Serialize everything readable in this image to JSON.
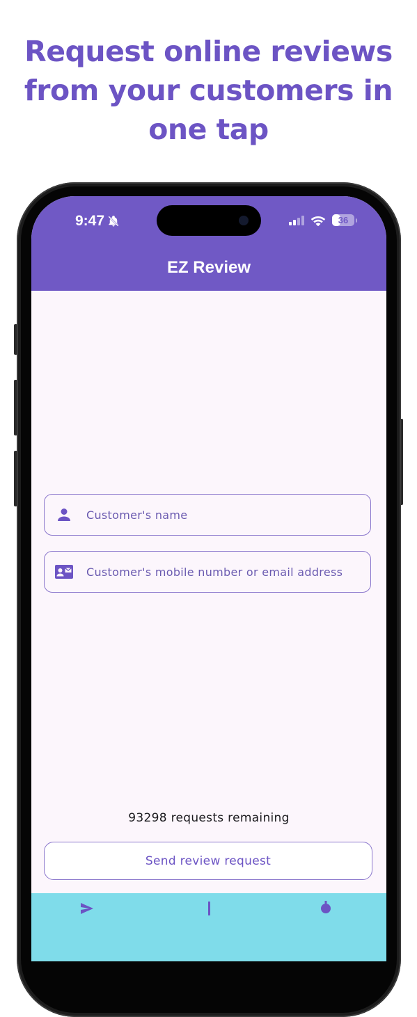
{
  "headline": {
    "line1": "Request online reviews",
    "line2": "from your customers in",
    "line3": "one tap"
  },
  "status_bar": {
    "time": "9:47",
    "battery": "36",
    "icons": [
      "bell-slash-icon",
      "cellular-signal-icon",
      "wifi-icon",
      "battery-icon"
    ]
  },
  "app": {
    "title": "EZ Review"
  },
  "form": {
    "name_placeholder": "Customer's name",
    "contact_placeholder": "Customer's mobile number or email address",
    "name_icon": "person-icon",
    "contact_icon": "contact-card-icon"
  },
  "requests_remaining": "93298 requests remaining",
  "send_button": "Send review request",
  "colors": {
    "primary": "#7059c5",
    "headline": "#6c54c4",
    "background": "#fcf6fc",
    "bottom_bar": "#7fdcea",
    "outline": "#8a76cc"
  }
}
